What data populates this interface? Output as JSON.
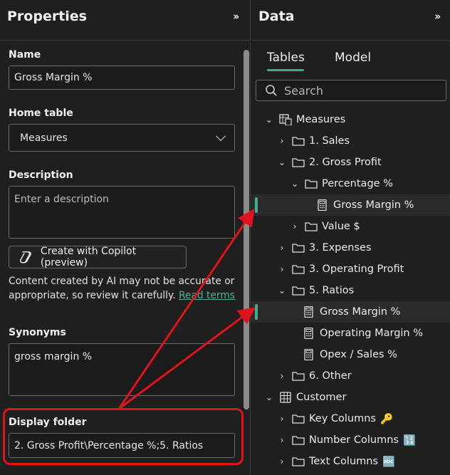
{
  "properties": {
    "title": "Properties",
    "collapse_icon": "double-chevron-right",
    "name_label": "Name",
    "name_value": "Gross Margin %",
    "home_table_label": "Home table",
    "home_table_value": "Measures",
    "description_label": "Description",
    "description_placeholder": "Enter a description",
    "copilot_button": "Create with Copilot (preview)",
    "disclaimer": "Content created by AI may not be accurate or appropriate, so review it carefully.",
    "read_terms": "Read terms",
    "synonyms_label": "Synonyms",
    "synonyms_value": "gross margin %",
    "display_folder_label": "Display folder",
    "display_folder_value": "2. Gross Profit\\Percentage %;5. Ratios"
  },
  "data_pane": {
    "title": "Data",
    "tabs": [
      "Tables",
      "Model"
    ],
    "active_tab": "Tables",
    "search_placeholder": "Search",
    "tree": [
      {
        "label": "Measures",
        "icon": "table-calculator-icon",
        "expanded": true
      },
      {
        "label": "1. Sales",
        "icon": "folder-icon",
        "expanded": false
      },
      {
        "label": "2. Gross Profit",
        "icon": "folder-icon",
        "expanded": true
      },
      {
        "label": "Percentage %",
        "icon": "folder-icon",
        "expanded": true
      },
      {
        "label": "Gross Margin %",
        "icon": "calculator-icon",
        "selected": true
      },
      {
        "label": "Value $",
        "icon": "folder-icon",
        "expanded": false
      },
      {
        "label": "3. Expenses",
        "icon": "folder-icon",
        "expanded": false
      },
      {
        "label": "3. Operating Profit",
        "icon": "folder-icon",
        "expanded": false
      },
      {
        "label": "5. Ratios",
        "icon": "folder-icon",
        "expanded": true
      },
      {
        "label": "Gross Margin %",
        "icon": "calculator-icon",
        "selected": true
      },
      {
        "label": "Operating Margin %",
        "icon": "calculator-icon"
      },
      {
        "label": "Opex / Sales %",
        "icon": "calculator-icon"
      },
      {
        "label": "6. Other",
        "icon": "folder-icon",
        "expanded": false
      },
      {
        "label": "Customer",
        "icon": "table-icon",
        "expanded": true
      },
      {
        "label": "Key Columns",
        "icon": "folder-icon",
        "badge": "🔑"
      },
      {
        "label": "Number Columns",
        "icon": "folder-icon",
        "badge": "🔢"
      },
      {
        "label": "Text Columns",
        "icon": "folder-icon",
        "badge": "🔤"
      }
    ]
  },
  "colors": {
    "accent": "#3fae97",
    "annotation_red": "#e0131c",
    "background": "#1f1f1f"
  }
}
